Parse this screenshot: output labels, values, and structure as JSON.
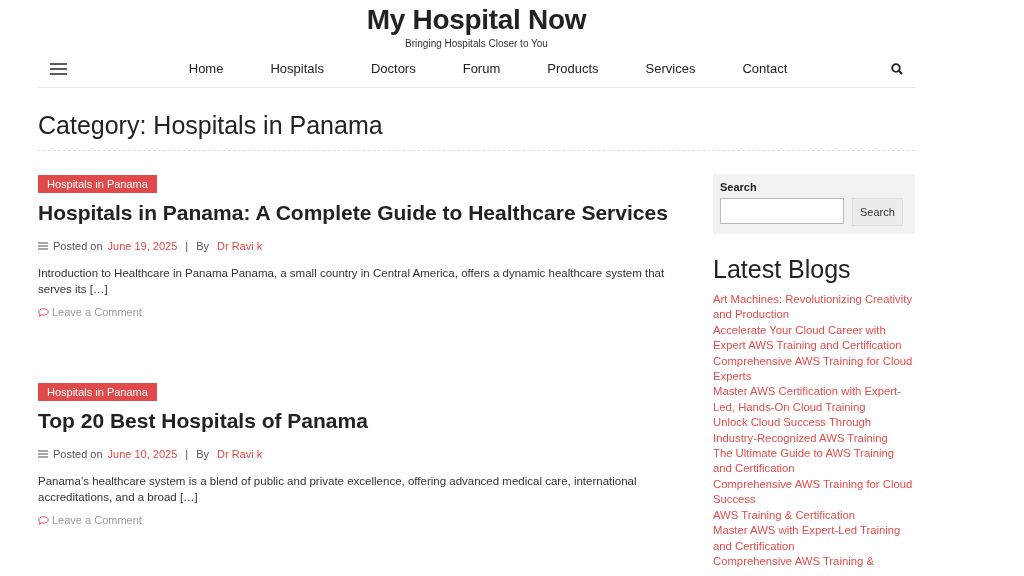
{
  "site": {
    "title": "My Hospital Now",
    "tagline": "Bringing Hospitals Closer to You"
  },
  "nav": {
    "items": [
      {
        "label": "Home"
      },
      {
        "label": "Hospitals"
      },
      {
        "label": "Doctors"
      },
      {
        "label": "Forum"
      },
      {
        "label": "Products"
      },
      {
        "label": "Services"
      },
      {
        "label": "Contact"
      }
    ]
  },
  "page_heading": "Category: Hospitals in Panama",
  "posts": [
    {
      "category": "Hospitals in Panama",
      "title": "Hospitals in Panama: A Complete Guide to Healthcare Services",
      "posted_label": "Posted on",
      "date": "June 19, 2025",
      "separator": "|",
      "by_label": "By",
      "author": "Dr Ravi k",
      "excerpt": "Introduction to Healthcare in Panama Panama, a small country in Central America, offers a dynamic healthcare system that serves its […]",
      "comment_link": "Leave a Comment"
    },
    {
      "category": "Hospitals in Panama",
      "title": "Top 20 Best Hospitals of Panama",
      "posted_label": "Posted on",
      "date": "June 10, 2025",
      "separator": "|",
      "by_label": "By",
      "author": "Dr Ravi k",
      "excerpt": "Panama’s healthcare system is a blend of public and private excellence, offering advanced medical care, international accreditations, and a broad […]",
      "comment_link": "Leave a Comment"
    }
  ],
  "sidebar": {
    "search": {
      "heading": "Search",
      "button": "Search"
    },
    "latest_blogs": {
      "heading": "Latest Blogs",
      "items": [
        "Art Machines: Revolutionizing Creativity and Production",
        "Accelerate Your Cloud Career with Expert AWS Training and Certification",
        "Comprehensive AWS Training for Cloud Experts",
        "Master AWS Certification with Expert-Led, Hands-On Cloud Training",
        "Unlock Cloud Success Through Industry-Recognized AWS Training",
        "The Ultimate Guide to AWS Training and Certification",
        "Comprehensive AWS Training for Cloud Success",
        "AWS Training & Certification",
        "Master AWS with Expert-Led Training and Certification",
        "Comprehensive AWS Training &"
      ]
    }
  }
}
